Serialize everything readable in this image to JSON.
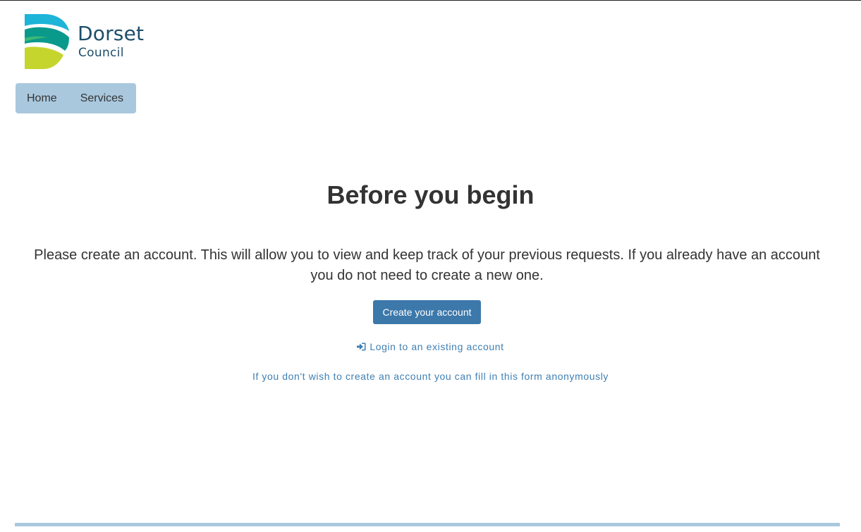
{
  "header": {
    "logo": {
      "name": "Dorset",
      "subname": "Council",
      "colors": [
        "#1eb4d8",
        "#0a9a8c",
        "#c6d52d",
        "#1d4e6b"
      ]
    }
  },
  "nav": {
    "items": [
      {
        "label": "Home"
      },
      {
        "label": "Services"
      }
    ],
    "background": "#a9c8de"
  },
  "main": {
    "title": "Before you begin",
    "intro": "Please create an account. This will allow you to view and keep track of your previous requests. If you already have an account you do not need to create a new one.",
    "create_button": "Create your account",
    "login_icon": "sign-in-icon",
    "login_link": "Login to an existing account",
    "anonymous_link": "If you don't wish to create an account you can fill in this form anonymously",
    "accent_color": "#3c78aa",
    "link_color": "#3f7fb3"
  }
}
